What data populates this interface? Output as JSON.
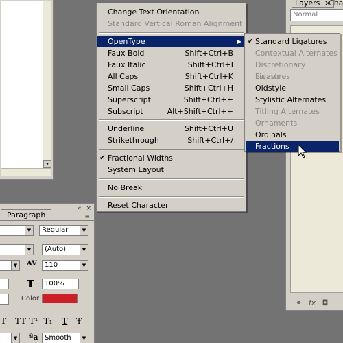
{
  "doc_window": {
    "scroll_arrow": "▾"
  },
  "char_panel": {
    "tab_label": "Paragraph",
    "top_controls": [
      "«",
      "×"
    ],
    "menu_icon": "≡",
    "font_style": "Regular",
    "leading": "(Auto)",
    "tracking": "110",
    "vertical_scale": "100%",
    "color_label": "Color:",
    "color_hex": "#cc1f28",
    "aa_mode": "Smooth",
    "style_glyphs": [
      "T",
      "TT",
      "T¹",
      "T₁",
      "T",
      "Ŧ"
    ]
  },
  "layers_panel": {
    "layers_tab": "Layers",
    "close": "×",
    "channels_tab": "Cha",
    "blend_mode": "Normal",
    "bottom_icons": [
      "link-icon",
      "fx-icon",
      "mask-icon"
    ],
    "bottom_glyphs": [
      "⚭",
      "fx",
      "◘"
    ]
  },
  "main_menu": {
    "items": [
      {
        "label": "Change Text Orientation",
        "shortcut": "",
        "enabled": true
      },
      {
        "label": "Standard Vertical Roman Alignment",
        "shortcut": "",
        "enabled": false
      },
      {
        "label": "OpenType",
        "shortcut": "",
        "submenu_arrow": "▶",
        "highlighted": true
      },
      {
        "label": "Faux Bold",
        "shortcut": "Shift+Ctrl+B"
      },
      {
        "label": "Faux Italic",
        "shortcut": "Shift+Ctrl+I"
      },
      {
        "label": "All Caps",
        "shortcut": "Shift+Ctrl+K"
      },
      {
        "label": "Small Caps",
        "shortcut": "Shift+Ctrl+H"
      },
      {
        "label": "Superscript",
        "shortcut": "Shift+Ctrl++"
      },
      {
        "label": "Subscript",
        "shortcut": "Alt+Shift+Ctrl++"
      },
      {
        "label": "Underline",
        "shortcut": "Shift+Ctrl+U"
      },
      {
        "label": "Strikethrough",
        "shortcut": "Shift+Ctrl+/"
      },
      {
        "label": "Fractional Widths",
        "shortcut": "",
        "checked": true,
        "check": "✔"
      },
      {
        "label": "System Layout",
        "shortcut": ""
      },
      {
        "label": "No Break",
        "shortcut": ""
      },
      {
        "label": "Reset Character",
        "shortcut": ""
      }
    ]
  },
  "opentype_menu": {
    "items": [
      {
        "label": "Standard Ligatures",
        "enabled": true,
        "checked": true,
        "check": "✔"
      },
      {
        "label": "Contextual Alternates",
        "enabled": false
      },
      {
        "label": "Discretionary Ligatures",
        "enabled": false
      },
      {
        "label": "Swash",
        "enabled": false
      },
      {
        "label": "Oldstyle",
        "enabled": true
      },
      {
        "label": "Stylistic Alternates",
        "enabled": true
      },
      {
        "label": "Titling Alternates",
        "enabled": false
      },
      {
        "label": "Ornaments",
        "enabled": false
      },
      {
        "label": "Ordinals",
        "enabled": true
      },
      {
        "label": "Fractions",
        "enabled": true,
        "highlighted": true
      }
    ]
  }
}
